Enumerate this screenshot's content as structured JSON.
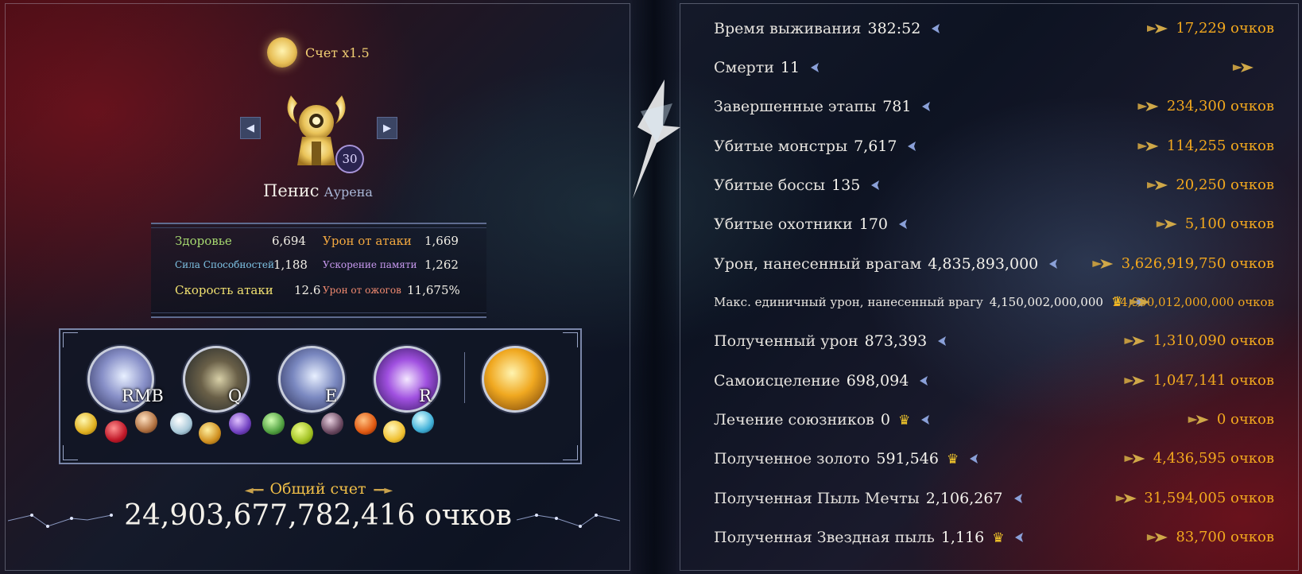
{
  "score_multiplier": "Счет x1.5",
  "hero": {
    "name": "Пенис",
    "class": "Аурена",
    "level": "30"
  },
  "stats": [
    {
      "label": "Здоровье",
      "value": "6,694",
      "color": "#a6d870"
    },
    {
      "label": "Урон от атаки",
      "value": "1,669",
      "color": "#f2a840"
    },
    {
      "label": "Сила Способностей",
      "value": "1,188",
      "color": "#7fc4e6"
    },
    {
      "label": "Ускорение памяти",
      "value": "1,262",
      "color": "#c89af0"
    },
    {
      "label": "Скорость атаки",
      "value": "12.6",
      "color": "#f0e070"
    },
    {
      "label": "Урон от ожогов",
      "value": "11,675%",
      "color": "#f08a70"
    }
  ],
  "skills": [
    {
      "key": "RMB",
      "icon": "wing-slash-icon"
    },
    {
      "key": "Q",
      "icon": "triple-spear-icon"
    },
    {
      "key": "E",
      "icon": "wing-dash-icon"
    },
    {
      "key": "R",
      "icon": "lightning-strike-icon"
    },
    {
      "key": "",
      "icon": "golden-claw-icon"
    }
  ],
  "items": [
    "yellow-crystal-icon",
    "red-gem-icon",
    "bronze-orb-icon",
    "diamond-icon",
    "golden-cross-icon",
    "purple-crystal-icon",
    "green-feather-icon",
    "green-gem-icon",
    "dark-orb-icon",
    "fire-swirl-icon",
    "gold-nugget-icon",
    "blue-crystal-icon"
  ],
  "total": {
    "title": "Общий счет",
    "value": "24,903,677,782,416 очков"
  },
  "breakdown": [
    {
      "label": "Время выживания",
      "value": "382:52",
      "points": "17,229 очков",
      "crown": false
    },
    {
      "label": "Смерти",
      "value": "11",
      "points": "",
      "crown": false
    },
    {
      "label": "Завершенные этапы",
      "value": "781",
      "points": "234,300 очков",
      "crown": false
    },
    {
      "label": "Убитые монстры",
      "value": "7,617",
      "points": "114,255 очков",
      "crown": false
    },
    {
      "label": "Убитые боссы",
      "value": "135",
      "points": "20,250 очков",
      "crown": false
    },
    {
      "label": "Убитые охотники",
      "value": "170",
      "points": "5,100 очков",
      "crown": false
    },
    {
      "label": "Урон, нанесенный врагам",
      "value": "4,835,893,000",
      "points": "3,626,919,750 очков",
      "crown": false
    },
    {
      "label": "Макс. единичный урон, нанесенный врагу",
      "value": "4,150,002,000,000",
      "points": "24,900,012,000,000 очков",
      "crown": true
    },
    {
      "label": "Полученный урон",
      "value": "873,393",
      "points": "1,310,090 очков",
      "crown": false
    },
    {
      "label": "Самоисцеление",
      "value": "698,094",
      "points": "1,047,141 очков",
      "crown": false
    },
    {
      "label": "Лечение союзников",
      "value": "0",
      "points": "0 очков",
      "crown": true
    },
    {
      "label": "Полученное золото",
      "value": "591,546",
      "points": "4,436,595 очков",
      "crown": true
    },
    {
      "label": "Полученная Пыль Мечты",
      "value": "2,106,267",
      "points": "31,594,005 очков",
      "crown": false
    },
    {
      "label": "Полученная Звездная пыль",
      "value": "1,116",
      "points": "83,700 очков",
      "crown": true
    }
  ]
}
